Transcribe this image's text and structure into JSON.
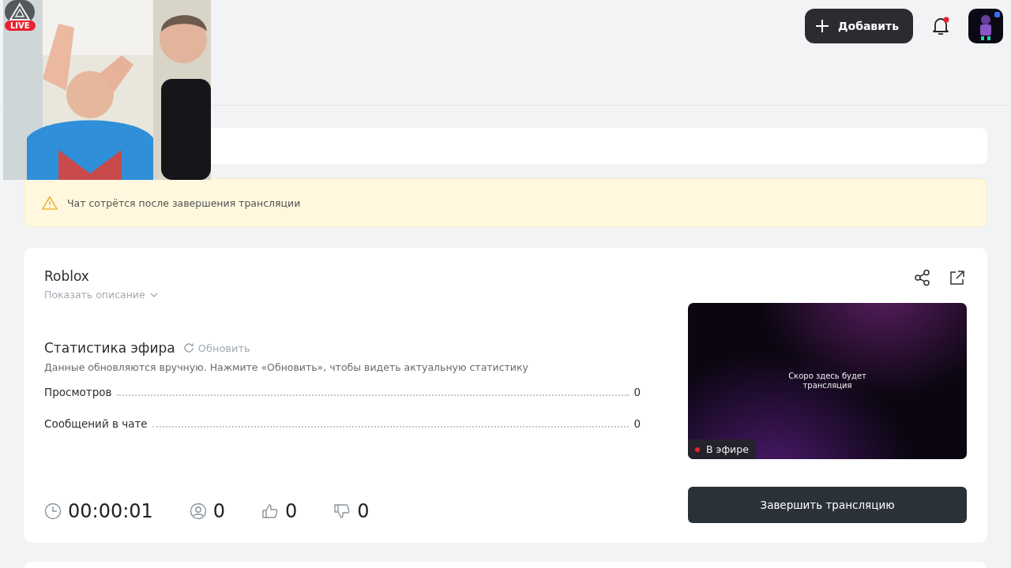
{
  "camera_overlay": {
    "kind": "picture",
    "live_badge": "LIVE"
  },
  "header": {
    "add_button": "Добавить",
    "notifications": {
      "unread": true
    }
  },
  "notice": {
    "text": "Чат сотрётся после завершения трансляции"
  },
  "stream": {
    "title": "Roblox",
    "show_description": "Показать описание",
    "stats": {
      "title": "Статистика эфира",
      "refresh": "Обновить",
      "hint": "Данные обновляются вручную. Нажмите «Обновить», чтобы видеть актуальную статистику",
      "rows": [
        {
          "label": "Просмотров",
          "value": "0"
        },
        {
          "label": "Сообщений в чате",
          "value": "0"
        }
      ]
    },
    "counters": [
      {
        "kind": "time",
        "value": "00:00:01"
      },
      {
        "kind": "viewers",
        "value": "0"
      },
      {
        "kind": "likes",
        "value": "0"
      },
      {
        "kind": "dislikes",
        "value": "0"
      }
    ],
    "preview": {
      "message": "Скоро здесь будет трансляция",
      "status": "В эфире",
      "live": true
    },
    "end_button": "Завершить трансляцию"
  }
}
